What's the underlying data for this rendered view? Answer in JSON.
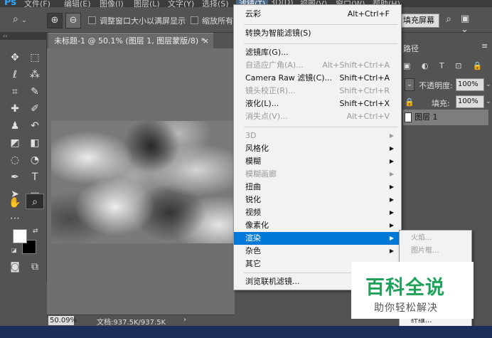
{
  "app": {
    "logo": "Ps"
  },
  "menubar": {
    "items": [
      "文件(F)",
      "编辑(E)",
      "图像(I)",
      "图层(L)",
      "文字(Y)",
      "选择(S)",
      "滤镜(T)",
      "3D(D)",
      "视图(V)",
      "窗口(W)",
      "帮助(H)"
    ]
  },
  "options": {
    "zoom_in_icon": "zoom-in-icon",
    "zoom_out_icon": "zoom-out-icon",
    "resize_windows_label": "调整窗口大小以满屏显示",
    "zoom_all_label": "缩放所有窗口",
    "fill_screen_label": "填充屏幕"
  },
  "document": {
    "tab_title": "未标题-1 @ 50.1% (图层 1, 图层蒙版/8) *",
    "close": "×"
  },
  "status": {
    "zoom": "50.09%",
    "doc_info": "文档:937.5K/937.5K",
    "arrow": "›"
  },
  "filter_menu": {
    "items": [
      {
        "label": "云彩",
        "shortcut": "Alt+Ctrl+F",
        "disabled": false
      },
      {
        "label": "转换为智能滤镜(S)",
        "shortcut": "",
        "disabled": false
      },
      {
        "label": "滤镜库(G)...",
        "shortcut": "",
        "disabled": false
      },
      {
        "label": "自适应广角(A)...",
        "shortcut": "Alt+Shift+Ctrl+A",
        "disabled": true
      },
      {
        "label": "Camera Raw 滤镜(C)...",
        "shortcut": "Shift+Ctrl+A",
        "disabled": false
      },
      {
        "label": "镜头校正(R)...",
        "shortcut": "Shift+Ctrl+R",
        "disabled": true
      },
      {
        "label": "液化(L)...",
        "shortcut": "Shift+Ctrl+X",
        "disabled": false
      },
      {
        "label": "消失点(V)...",
        "shortcut": "Alt+Ctrl+V",
        "disabled": true
      },
      {
        "label": "3D",
        "disabled": true
      },
      {
        "label": "风格化",
        "disabled": false
      },
      {
        "label": "模糊",
        "disabled": false
      },
      {
        "label": "模糊画廊",
        "disabled": true
      },
      {
        "label": "扭曲",
        "disabled": false
      },
      {
        "label": "锐化",
        "disabled": false
      },
      {
        "label": "视频",
        "disabled": false
      },
      {
        "label": "像素化",
        "disabled": false
      },
      {
        "label": "渲染",
        "disabled": false
      },
      {
        "label": "杂色",
        "disabled": false
      },
      {
        "label": "其它",
        "disabled": false
      },
      {
        "label": "浏览联机滤镜...",
        "disabled": false
      }
    ]
  },
  "render_submenu": {
    "items": [
      "火焰...",
      "图片框...",
      "纤维...",
      "云彩"
    ]
  },
  "panels": {
    "paths_tab": "路径",
    "opacity_label": "不透明度:",
    "opacity_value": "100%",
    "fill_label": "填充:",
    "fill_value": "100%",
    "layer_name": "图层 1",
    "filter_icons": "▣ ◐ T ⊡ 🔒"
  },
  "watermark": {
    "title": "百科全说",
    "subtitle": "助你轻松解决"
  }
}
